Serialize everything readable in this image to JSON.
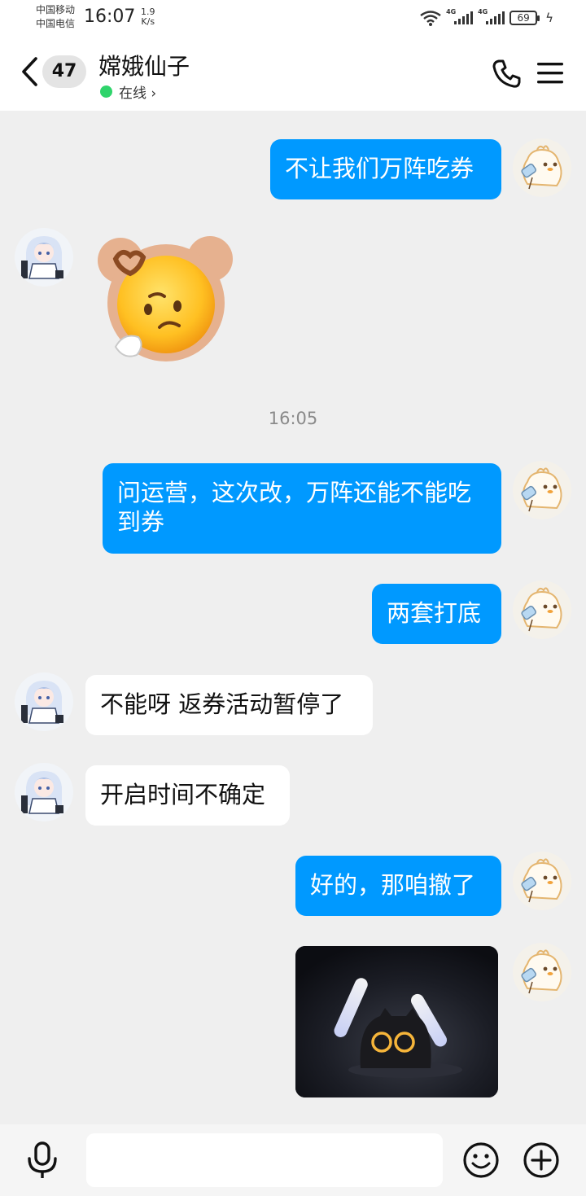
{
  "status_bar": {
    "carrier_1": "中国移动",
    "carrier_2": "中国电信",
    "time": "16:07",
    "speed_value": "1.9",
    "speed_unit": "K/s",
    "network_1": "4G",
    "network_2": "4G",
    "battery": "69"
  },
  "header": {
    "back_icon": "chevron-left-icon",
    "unread_count": "47",
    "contact_name": "嫦娥仙子",
    "status_text": "在线 ›",
    "call_icon": "phone-icon",
    "menu_icon": "menu-icon"
  },
  "chat": {
    "timestamp": "16:05",
    "messages": [
      {
        "from": "me",
        "text": "不让我们万阵吃券"
      },
      {
        "from": "them",
        "type": "sticker",
        "icon": "bear-emoji-sticker"
      },
      {
        "from": "me",
        "text": "问运营，这次改，万阵还能不能吃到券"
      },
      {
        "from": "me",
        "text": "两套打底"
      },
      {
        "from": "them",
        "text": "不能呀 返券活动暂停了"
      },
      {
        "from": "them",
        "text": "开启时间不确定"
      },
      {
        "from": "me",
        "text": "好的，那咱撤了"
      },
      {
        "from": "me",
        "type": "image",
        "icon": "black-cat-figure-photo"
      }
    ]
  },
  "input_bar": {
    "voice_icon": "microphone-icon",
    "placeholder": "",
    "emoji_icon": "smiley-icon",
    "more_icon": "plus-circle-icon"
  },
  "colors": {
    "my_bubble": "#0099ff",
    "their_bubble": "#ffffff",
    "chat_background": "#efefef",
    "online_dot": "#2fd46b"
  }
}
